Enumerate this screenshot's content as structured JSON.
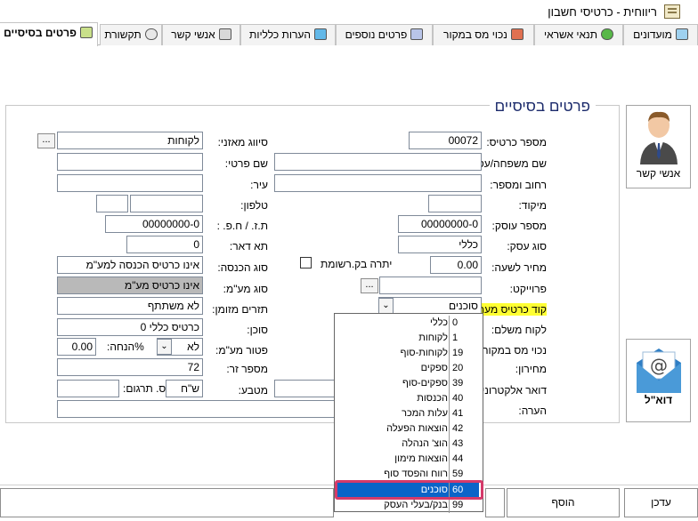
{
  "window": {
    "title": "ריווחית - כרטיסי חשבון"
  },
  "tabs": [
    {
      "label": "פרטים בסיסיים",
      "active": true
    },
    {
      "label": "מועדונים"
    },
    {
      "label": "תנאי אשראי"
    },
    {
      "label": "נכוי מס במקור"
    },
    {
      "label": "פרטים נוספים"
    },
    {
      "label": "הערות כלליות"
    },
    {
      "label": "אנשי קשר"
    },
    {
      "label": "תקשורת"
    }
  ],
  "form": {
    "heading": "פרטים בסיסיים",
    "card_number": {
      "label": "מספר כרטיס:",
      "value": "00072"
    },
    "family_name": {
      "label": "שם משפחה/עסק:",
      "value": ""
    },
    "street": {
      "label": "רחוב ומספר:",
      "value": ""
    },
    "zip": {
      "label": "מיקוד:",
      "value": ""
    },
    "business_number": {
      "label": "מספר עוסק:",
      "value": "00000000-0"
    },
    "business_type": {
      "label": "סוג עסק:",
      "value": "כללי"
    },
    "hourly_price": {
      "label": "מחיר לשעה:",
      "value": "0.00"
    },
    "recorded_balance": {
      "label": "יתרה בק.רשומת"
    },
    "project": {
      "label": "פרוייקט:",
      "value": ""
    },
    "system_card_code": {
      "label": "קוד כרטיס מערכת:",
      "value": "סוכנים"
    },
    "paying_customer": {
      "label": "לקוח משלם:"
    },
    "withholding_tax": {
      "label": "נכוי מס במקור/ה.שער:"
    },
    "price_list": {
      "label": "מחירון:"
    },
    "email": {
      "label": "דואר אלקטרוני:"
    },
    "note": {
      "label": "הערה:"
    },
    "balance_class": {
      "label": "סיווג מאזני:",
      "value": "לקוחות"
    },
    "first_name": {
      "label": "שם פרטי:",
      "value": ""
    },
    "city": {
      "label": "עיר:",
      "value": ""
    },
    "phone": {
      "label": "טלפון:",
      "value": ""
    },
    "id_number": {
      "label": "ת.ז. / ח.פ. :",
      "value": "00000000-0"
    },
    "po_box": {
      "label": "תא דאר:",
      "value": "0"
    },
    "income_type": {
      "label": "סוג הכנסה:",
      "value": "אינו כרטיס הכנסה למע\"מ"
    },
    "vat_type": {
      "label": "סוג מע\"מ:",
      "value": "אינו כרטיס מע\"מ"
    },
    "cash_flow": {
      "label": "תזרים מזומן:",
      "value": "לא משתתף"
    },
    "agent": {
      "label": "סוכן:",
      "value": "כרטיס כללי 0"
    },
    "vat_exempt": {
      "label": "פטור מע\"מ:",
      "value": "לא"
    },
    "discount": {
      "label": "%הנחה:",
      "value": "0.00"
    },
    "foreign_number": {
      "label": "מספר זר:",
      "value": "72"
    },
    "currency": {
      "label": "מטבע:",
      "value": "ש\"ח"
    },
    "translation": {
      "label": "ס. תרגום:",
      "value": ""
    }
  },
  "dropdown": {
    "items": [
      {
        "num": "0",
        "name": "כללי"
      },
      {
        "num": "1",
        "name": "לקוחות"
      },
      {
        "num": "19",
        "name": "לקוחות-סוף"
      },
      {
        "num": "20",
        "name": "ספקים"
      },
      {
        "num": "39",
        "name": "ספקים-סוף"
      },
      {
        "num": "40",
        "name": "הכנסות"
      },
      {
        "num": "41",
        "name": "עלות המכר"
      },
      {
        "num": "42",
        "name": "הוצאות הפעלה"
      },
      {
        "num": "43",
        "name": "הוצ' הנהלה"
      },
      {
        "num": "44",
        "name": "הוצאות מימון"
      },
      {
        "num": "59",
        "name": "רווח והפסד סוף"
      },
      {
        "num": "60",
        "name": "סוכנים",
        "selected": true
      },
      {
        "num": "99",
        "name": "בנק/בעלי העסק"
      }
    ]
  },
  "side": {
    "contacts_label": "אנשי קשר",
    "email_label": "דוא\"ל"
  },
  "buttons": {
    "update": "עדכן",
    "add": "הוסף"
  },
  "icons": {
    "dots": "...",
    "dd_arrow": "⌄"
  },
  "colors": {
    "accent": "#0a64c8",
    "highlight_border": "#d53a6a",
    "label_highlight": "#ffff33",
    "heading": "#1b2a6b"
  }
}
